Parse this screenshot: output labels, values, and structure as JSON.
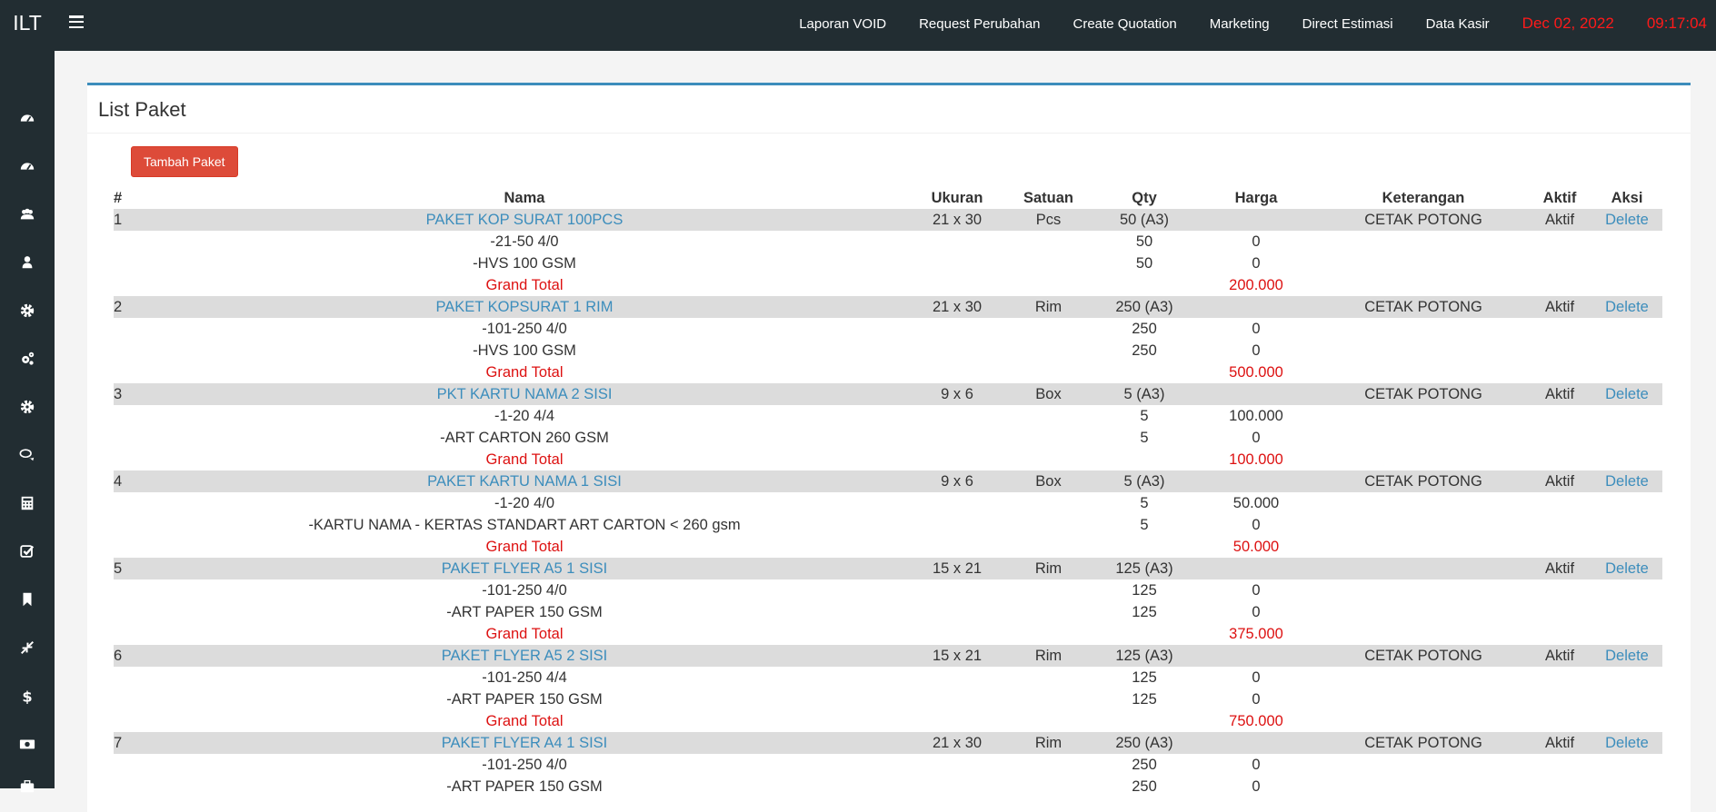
{
  "app": {
    "brand": "ILT"
  },
  "header": {
    "nav": [
      "Laporan VOID",
      "Request Perubahan",
      "Create Quotation",
      "Marketing",
      "Direct Estimasi",
      "Data Kasir"
    ],
    "date": "Dec 02, 2022",
    "time": "09:17:04",
    "accent_color": "#ff1a1a"
  },
  "sidebar": {
    "icons": [
      "dashboard-icon",
      "dashboard-icon",
      "users-icon",
      "user-icon",
      "gear-icon",
      "gears-icon",
      "gear-icon",
      "comments-icon",
      "calculator-icon",
      "check-square-icon",
      "bookmark-icon",
      "compress-icon",
      "dollar-icon",
      "money-icon",
      "briefcase-icon"
    ]
  },
  "main": {
    "title": "List Paket",
    "add_button": "Tambah Paket",
    "columns": [
      "#",
      "Nama",
      "Ukuran",
      "Satuan",
      "Qty",
      "Harga",
      "Keterangan",
      "Aktif",
      "Aksi"
    ],
    "grand_total_label": "Grand Total",
    "delete_label": "Delete",
    "packages": [
      {
        "no": "1",
        "name": "PAKET KOP SURAT 100PCS",
        "size": "21 x 30",
        "unit": "Pcs",
        "qty": "50 (A3)",
        "note": "CETAK POTONG",
        "active": "Aktif",
        "items": [
          {
            "name": "-21-50 4/0",
            "qty": "50",
            "price": "0"
          },
          {
            "name": "-HVS 100 GSM",
            "qty": "50",
            "price": "0"
          }
        ],
        "grand_total": "200.000"
      },
      {
        "no": "2",
        "name": "PAKET KOPSURAT 1 RIM",
        "size": "21 x 30",
        "unit": "Rim",
        "qty": "250 (A3)",
        "note": "CETAK POTONG",
        "active": "Aktif",
        "items": [
          {
            "name": "-101-250 4/0",
            "qty": "250",
            "price": "0"
          },
          {
            "name": "-HVS 100 GSM",
            "qty": "250",
            "price": "0"
          }
        ],
        "grand_total": "500.000"
      },
      {
        "no": "3",
        "name": "PKT KARTU NAMA 2 SISI",
        "size": "9 x 6",
        "unit": "Box",
        "qty": "5 (A3)",
        "note": "CETAK POTONG",
        "active": "Aktif",
        "items": [
          {
            "name": "-1-20 4/4",
            "qty": "5",
            "price": "100.000"
          },
          {
            "name": "-ART CARTON 260 GSM",
            "qty": "5",
            "price": "0"
          }
        ],
        "grand_total": "100.000"
      },
      {
        "no": "4",
        "name": "PAKET KARTU NAMA 1 SISI",
        "size": "9 x 6",
        "unit": "Box",
        "qty": "5 (A3)",
        "note": "CETAK POTONG",
        "active": "Aktif",
        "items": [
          {
            "name": "-1-20 4/0",
            "qty": "5",
            "price": "50.000"
          },
          {
            "name": "-KARTU NAMA - KERTAS STANDART ART CARTON < 260 gsm",
            "qty": "5",
            "price": "0"
          }
        ],
        "grand_total": "50.000"
      },
      {
        "no": "5",
        "name": "PAKET FLYER A5 1 SISI",
        "size": "15 x 21",
        "unit": "Rim",
        "qty": "125 (A3)",
        "note": "",
        "active": "Aktif",
        "items": [
          {
            "name": "-101-250 4/0",
            "qty": "125",
            "price": "0"
          },
          {
            "name": "-ART PAPER 150 GSM",
            "qty": "125",
            "price": "0"
          }
        ],
        "grand_total": "375.000"
      },
      {
        "no": "6",
        "name": "PAKET FLYER A5 2 SISI",
        "size": "15 x 21",
        "unit": "Rim",
        "qty": "125 (A3)",
        "note": "CETAK POTONG",
        "active": "Aktif",
        "items": [
          {
            "name": "-101-250 4/4",
            "qty": "125",
            "price": "0"
          },
          {
            "name": "-ART PAPER 150 GSM",
            "qty": "125",
            "price": "0"
          }
        ],
        "grand_total": "750.000"
      },
      {
        "no": "7",
        "name": "PAKET FLYER A4 1 SISI",
        "size": "21 x 30",
        "unit": "Rim",
        "qty": "250 (A3)",
        "note": "CETAK POTONG",
        "active": "Aktif",
        "items": [
          {
            "name": "-101-250 4/0",
            "qty": "250",
            "price": "0"
          },
          {
            "name": "-ART PAPER 150 GSM",
            "qty": "250",
            "price": "0"
          }
        ],
        "grand_total": ""
      }
    ]
  }
}
